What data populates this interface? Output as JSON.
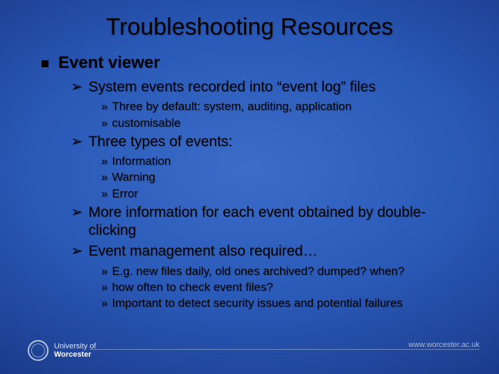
{
  "title": "Troubleshooting Resources",
  "heading": "Event viewer",
  "bullets": {
    "b1": "System events recorded into “event log” files",
    "b1_1": "Three by default: system, auditing, application",
    "b1_2": "customisable",
    "b2": "Three types of events:",
    "b2_1": "Information",
    "b2_2": "Warning",
    "b2_3": "Error",
    "b3": "More information for each event obtained by double-clicking",
    "b4": "Event management also required…",
    "b4_1": "E.g. new files daily, old ones archived? dumped? when?",
    "b4_2": "how often to check event files?",
    "b4_3": "Important to detect security issues and potential failures"
  },
  "glyphs": {
    "square": "■",
    "chevron": "➢",
    "raquo": "»"
  },
  "footer": {
    "uni_line1": "University of",
    "uni_line2": "Worcester",
    "url": "www.worcester.ac.uk"
  }
}
